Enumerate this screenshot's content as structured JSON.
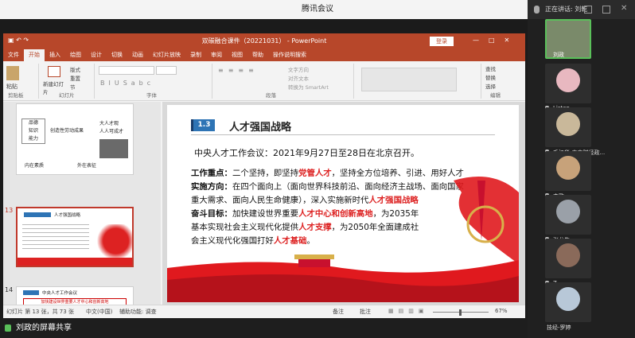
{
  "meeting": {
    "title": "腾讯会议",
    "speaker": "正在讲话: 刘乾",
    "share_label": "刘政的屏幕共享"
  },
  "ppt": {
    "title": "双碳融合课件（20221031） - PowerPoint",
    "login": "登录",
    "tabs": [
      "文件",
      "开始",
      "插入",
      "绘图",
      "设计",
      "切换",
      "动画",
      "幻灯片放映",
      "录制",
      "审阅",
      "视图",
      "帮助",
      "操作说明搜索"
    ],
    "ribbon": {
      "paste": "粘贴",
      "clipboard": "剪贴板",
      "new_slide": "新建幻灯片",
      "slides": "幻灯片",
      "layout": "版式",
      "reset": "重置",
      "section": "节",
      "font": "字体",
      "paragraph": "段落",
      "text_direction": "文字方向",
      "align_text": "对齐文本",
      "smartart": "转换为 SmartArt",
      "find": "查找",
      "replace": "替换",
      "select": "选择",
      "editing": "编辑"
    },
    "thumbs": {
      "t12_lines": [
        "品德",
        "知识",
        "能力"
      ],
      "t12_mid": "创造性劳动成果",
      "t12_right": [
        "大人才观",
        "人人可成才"
      ],
      "t12_bottom": [
        "内在素质",
        "外在表征"
      ],
      "t13_num": "13",
      "t13_title": "人才强国战略",
      "t14_num": "14",
      "t14_title": "中央人才工作会议",
      "t14_line": "加快建设世界重要人才中心和创新高地"
    },
    "slide": {
      "badge": "1.3",
      "heading": "人才强国战略",
      "intro": "中央人才工作会议：2021年9月27日至28日在北京召开。",
      "p1_label": "工作重点：",
      "p1_a": "二个坚持，即坚持",
      "p1_red": "党管人才",
      "p1_b": "，坚持全方位培养、引进、用好人才",
      "p2_label": "实施方向：",
      "p2_a": "在四个面向上（面向世界科技前沿、面向经济主战场、面向国家",
      "p2_line2": "重大需求、面向人民生命健康），深入实施新时代",
      "p2_red": "人才强国战略",
      "p3_label": "奋斗目标：",
      "p3_a": "加快建设世界重要",
      "p3_red1": "人才中心和创新高地",
      "p3_b": "，为2035年",
      "p3_line2a": "基本实现社会主义现代化提供",
      "p3_red2": "人才支撑",
      "p3_line2b": "，为2050年全面建成社",
      "p3_line3a": "会主义现代化强国打好",
      "p3_red3": "人才基础",
      "p3_line3b": "。"
    },
    "status": {
      "slide_info": "幻灯片 第 13 张，共 73 张",
      "lang": "中文(中国)",
      "access": "辅助功能: 调查",
      "notes": "备注",
      "comments": "批注",
      "zoom": "67%"
    }
  },
  "participants": [
    {
      "name": "刘政",
      "avatar": "#7a8a6a"
    },
    {
      "name": "Listen",
      "avatar": "#e8b8c0"
    },
    {
      "name": "毛江华-中南财经政...",
      "avatar": "#c9b89a"
    },
    {
      "name": "李歌",
      "avatar": "#c7a27a"
    },
    {
      "name": "张龙生",
      "avatar": "#9aa0a8"
    },
    {
      "name": "Z.",
      "avatar": "#8a6a5a"
    },
    {
      "name": "技经-罗婷",
      "avatar": "#b8c8d8"
    }
  ]
}
